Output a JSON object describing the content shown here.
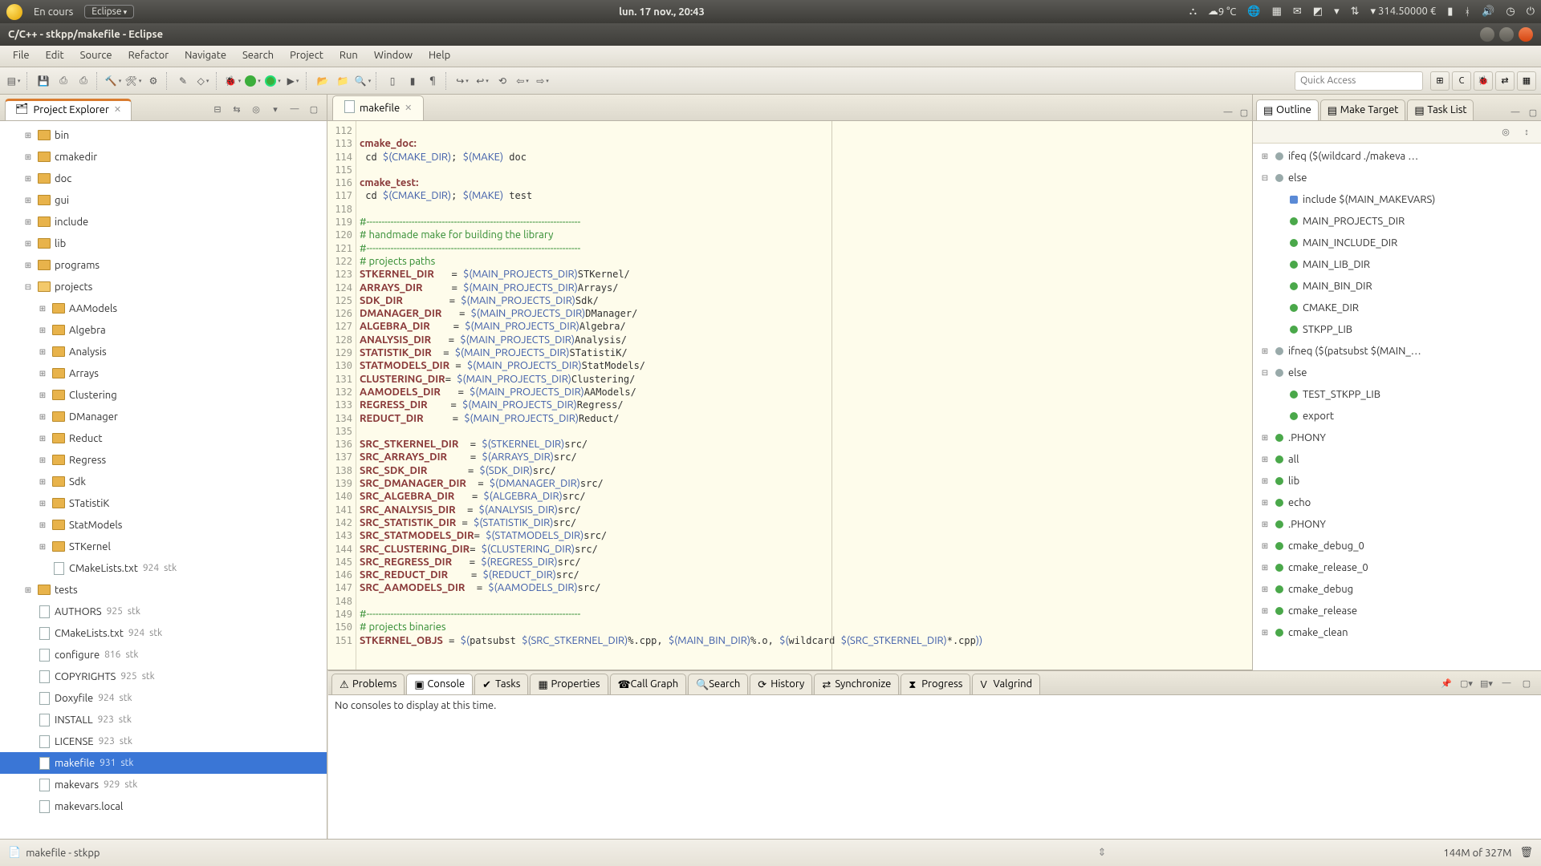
{
  "sys": {
    "app_running": "En cours",
    "eclipse_badge": "Eclipse",
    "clock": "lun. 17 nov., 20:43",
    "weather": "9 °C",
    "cost": "▾ 314.50000 €"
  },
  "window": {
    "title": "C/C++ - stkpp/makefile - Eclipse"
  },
  "menu": [
    "File",
    "Edit",
    "Source",
    "Refactor",
    "Navigate",
    "Search",
    "Project",
    "Run",
    "Window",
    "Help"
  ],
  "quick_access_placeholder": "Quick Access",
  "explorer": {
    "title": "Project Explorer",
    "tree": [
      {
        "tw": "⊞",
        "icon": "folder",
        "label": "bin",
        "ind": 1
      },
      {
        "tw": "⊞",
        "icon": "folder",
        "label": "cmakedir",
        "ind": 1
      },
      {
        "tw": "⊞",
        "icon": "folder",
        "label": "doc",
        "ind": 1
      },
      {
        "tw": "⊞",
        "icon": "folder",
        "label": "gui",
        "ind": 1
      },
      {
        "tw": "⊞",
        "icon": "folder",
        "label": "include",
        "ind": 1
      },
      {
        "tw": "⊞",
        "icon": "folder",
        "label": "lib",
        "ind": 1
      },
      {
        "tw": "⊞",
        "icon": "folder",
        "label": "programs",
        "ind": 1
      },
      {
        "tw": "⊟",
        "icon": "folder open",
        "label": "projects",
        "ind": 1
      },
      {
        "tw": "⊞",
        "icon": "folder",
        "label": "AAModels",
        "ind": 2
      },
      {
        "tw": "⊞",
        "icon": "folder",
        "label": "Algebra",
        "ind": 2
      },
      {
        "tw": "⊞",
        "icon": "folder",
        "label": "Analysis",
        "ind": 2
      },
      {
        "tw": "⊞",
        "icon": "folder",
        "label": "Arrays",
        "ind": 2
      },
      {
        "tw": "⊞",
        "icon": "folder",
        "label": "Clustering",
        "ind": 2
      },
      {
        "tw": "⊞",
        "icon": "folder",
        "label": "DManager",
        "ind": 2
      },
      {
        "tw": "⊞",
        "icon": "folder",
        "label": "Reduct",
        "ind": 2
      },
      {
        "tw": "⊞",
        "icon": "folder",
        "label": "Regress",
        "ind": 2
      },
      {
        "tw": "⊞",
        "icon": "folder",
        "label": "Sdk",
        "ind": 2
      },
      {
        "tw": "⊞",
        "icon": "folder",
        "label": "STatistiK",
        "ind": 2
      },
      {
        "tw": "⊞",
        "icon": "folder",
        "label": "StatModels",
        "ind": 2
      },
      {
        "tw": "⊞",
        "icon": "folder",
        "label": "STKernel",
        "ind": 2
      },
      {
        "tw": "",
        "icon": "file",
        "label": "CMakeLists.txt",
        "rev": "924",
        "tag": "stk",
        "ind": 2
      },
      {
        "tw": "⊞",
        "icon": "folder",
        "label": "tests",
        "ind": 1
      },
      {
        "tw": "",
        "icon": "file",
        "label": "AUTHORS",
        "rev": "925",
        "tag": "stk",
        "ind": 1
      },
      {
        "tw": "",
        "icon": "file",
        "label": "CMakeLists.txt",
        "rev": "924",
        "tag": "stk",
        "ind": 1
      },
      {
        "tw": "",
        "icon": "file",
        "label": "configure",
        "rev": "816",
        "tag": "stk",
        "ind": 1
      },
      {
        "tw": "",
        "icon": "file",
        "label": "COPYRIGHTS",
        "rev": "925",
        "tag": "stk",
        "ind": 1
      },
      {
        "tw": "",
        "icon": "file",
        "label": "Doxyfile",
        "rev": "924",
        "tag": "stk",
        "ind": 1
      },
      {
        "tw": "",
        "icon": "file",
        "label": "INSTALL",
        "rev": "923",
        "tag": "stk",
        "ind": 1
      },
      {
        "tw": "",
        "icon": "file",
        "label": "LICENSE",
        "rev": "923",
        "tag": "stk",
        "ind": 1
      },
      {
        "tw": "",
        "icon": "file",
        "label": "makefile",
        "rev": "931",
        "tag": "stk",
        "ind": 1,
        "selected": true
      },
      {
        "tw": "",
        "icon": "file",
        "label": "makevars",
        "rev": "929",
        "tag": "stk",
        "ind": 1
      },
      {
        "tw": "",
        "icon": "file",
        "label": "makevars.local",
        "ind": 1
      }
    ]
  },
  "editor": {
    "tab_label": "makefile",
    "first_line": 112,
    "lines": [
      "",
      "<k>cmake_doc:</k>",
      " cd <v>$(CMAKE_DIR)</v>; <v>$(MAKE)</v> doc",
      "",
      "<k>cmake_test:</k>",
      " cd <v>$(CMAKE_DIR)</v>; <v>$(MAKE)</v> test",
      "",
      "<c>#-----------------------------------------------------------------------</c>",
      "<c># handmade make for building the library</c>",
      "<c>#-----------------------------------------------------------------------</c>",
      "<c># projects paths</c>",
      "<k>STKERNEL_DIR</k>   = <v>$(MAIN_PROJECTS_DIR)</v>STKernel/",
      "<k>ARRAYS_DIR</k>     = <v>$(MAIN_PROJECTS_DIR)</v>Arrays/",
      "<k>SDK_DIR</k>        = <v>$(MAIN_PROJECTS_DIR)</v>Sdk/",
      "<k>DMANAGER_DIR</k>   = <v>$(MAIN_PROJECTS_DIR)</v>DManager/",
      "<k>ALGEBRA_DIR</k>    = <v>$(MAIN_PROJECTS_DIR)</v>Algebra/",
      "<k>ANALYSIS_DIR</k>   = <v>$(MAIN_PROJECTS_DIR)</v>Analysis/",
      "<k>STATISTIK_DIR</k>  = <v>$(MAIN_PROJECTS_DIR)</v>STatistiK/",
      "<k>STATMODELS_DIR</k> = <v>$(MAIN_PROJECTS_DIR)</v>StatModels/",
      "<k>CLUSTERING_DIR</k>= <v>$(MAIN_PROJECTS_DIR)</v>Clustering/",
      "<k>AAMODELS_DIR</k>   = <v>$(MAIN_PROJECTS_DIR)</v>AAModels/",
      "<k>REGRESS_DIR</k>    = <v>$(MAIN_PROJECTS_DIR)</v>Regress/",
      "<k>REDUCT_DIR</k>     = <v>$(MAIN_PROJECTS_DIR)</v>Reduct/",
      "",
      "<k>SRC_STKERNEL_DIR</k>  = <v>$(STKERNEL_DIR)</v>src/",
      "<k>SRC_ARRAYS_DIR</k>    = <v>$(ARRAYS_DIR)</v>src/",
      "<k>SRC_SDK_DIR</k>       = <v>$(SDK_DIR)</v>src/",
      "<k>SRC_DMANAGER_DIR</k>  = <v>$(DMANAGER_DIR)</v>src/",
      "<k>SRC_ALGEBRA_DIR</k>   = <v>$(ALGEBRA_DIR)</v>src/",
      "<k>SRC_ANALYSIS_DIR</k>  = <v>$(ANALYSIS_DIR)</v>src/",
      "<k>SRC_STATISTIK_DIR</k> = <v>$(STATISTIK_DIR)</v>src/",
      "<k>SRC_STATMODELS_DIR</k>= <v>$(STATMODELS_DIR)</v>src/",
      "<k>SRC_CLUSTERING_DIR</k>= <v>$(CLUSTERING_DIR)</v>src/",
      "<k>SRC_REGRESS_DIR</k>   = <v>$(REGRESS_DIR)</v>src/",
      "<k>SRC_REDUCT_DIR</k>    = <v>$(REDUCT_DIR)</v>src/",
      "<k>SRC_AAMODELS_DIR</k>  = <v>$(AAMODELS_DIR)</v>src/",
      "",
      "<c>#-----------------------------------------------------------------------</c>",
      "<c># projects binaries</c>",
      "<k>STKERNEL_OBJS</k> = <v>$(</v>patsubst <v>$(SRC_STKERNEL_DIR)</v>%.cpp, <v>$(MAIN_BIN_DIR)</v>%.o, <v>$(</v>wildcard <v>$(SRC_STKERNEL_DIR)</v>*.cpp<v>))</v>"
    ]
  },
  "outline": {
    "tabs": [
      "Outline",
      "Make Target",
      "Task List"
    ],
    "items": [
      {
        "tw": "⊞",
        "dot": "gy",
        "label": "ifeq ($(wildcard ./makeva …"
      },
      {
        "tw": "⊟",
        "dot": "gy",
        "label": "else"
      },
      {
        "tw": "",
        "dot": "sq",
        "label": "include $(MAIN_MAKEVARS)",
        "ind": true
      },
      {
        "tw": "",
        "dot": "",
        "label": "MAIN_PROJECTS_DIR",
        "ind": true
      },
      {
        "tw": "",
        "dot": "",
        "label": "MAIN_INCLUDE_DIR",
        "ind": true
      },
      {
        "tw": "",
        "dot": "",
        "label": "MAIN_LIB_DIR",
        "ind": true
      },
      {
        "tw": "",
        "dot": "",
        "label": "MAIN_BIN_DIR",
        "ind": true
      },
      {
        "tw": "",
        "dot": "",
        "label": "CMAKE_DIR",
        "ind": true
      },
      {
        "tw": "",
        "dot": "",
        "label": "STKPP_LIB",
        "ind": true
      },
      {
        "tw": "⊞",
        "dot": "gy",
        "label": "ifneq ($(patsubst $(MAIN_…"
      },
      {
        "tw": "⊟",
        "dot": "gy",
        "label": "else"
      },
      {
        "tw": "",
        "dot": "",
        "label": "TEST_STKPP_LIB",
        "ind": true
      },
      {
        "tw": "",
        "dot": "",
        "label": "export",
        "ind": true
      },
      {
        "tw": "⊞",
        "dot": "",
        "label": ".PHONY"
      },
      {
        "tw": "⊞",
        "dot": "",
        "label": "all"
      },
      {
        "tw": "⊞",
        "dot": "",
        "label": "lib"
      },
      {
        "tw": "⊞",
        "dot": "",
        "label": "echo"
      },
      {
        "tw": "⊞",
        "dot": "",
        "label": ".PHONY"
      },
      {
        "tw": "⊞",
        "dot": "",
        "label": "cmake_debug_0"
      },
      {
        "tw": "⊞",
        "dot": "",
        "label": "cmake_release_0"
      },
      {
        "tw": "⊞",
        "dot": "",
        "label": "cmake_debug"
      },
      {
        "tw": "⊞",
        "dot": "",
        "label": "cmake_release"
      },
      {
        "tw": "⊞",
        "dot": "",
        "label": "cmake_clean"
      }
    ]
  },
  "bottom": {
    "tabs": [
      "Problems",
      "Console",
      "Tasks",
      "Properties",
      "Call Graph",
      "Search",
      "History",
      "Synchronize",
      "Progress",
      "Valgrind"
    ],
    "active": 1,
    "message": "No consoles to display at this time."
  },
  "status": {
    "left_icon": "file-icon",
    "left_text": "makefile - stkpp",
    "heap": "144M of 327M"
  }
}
